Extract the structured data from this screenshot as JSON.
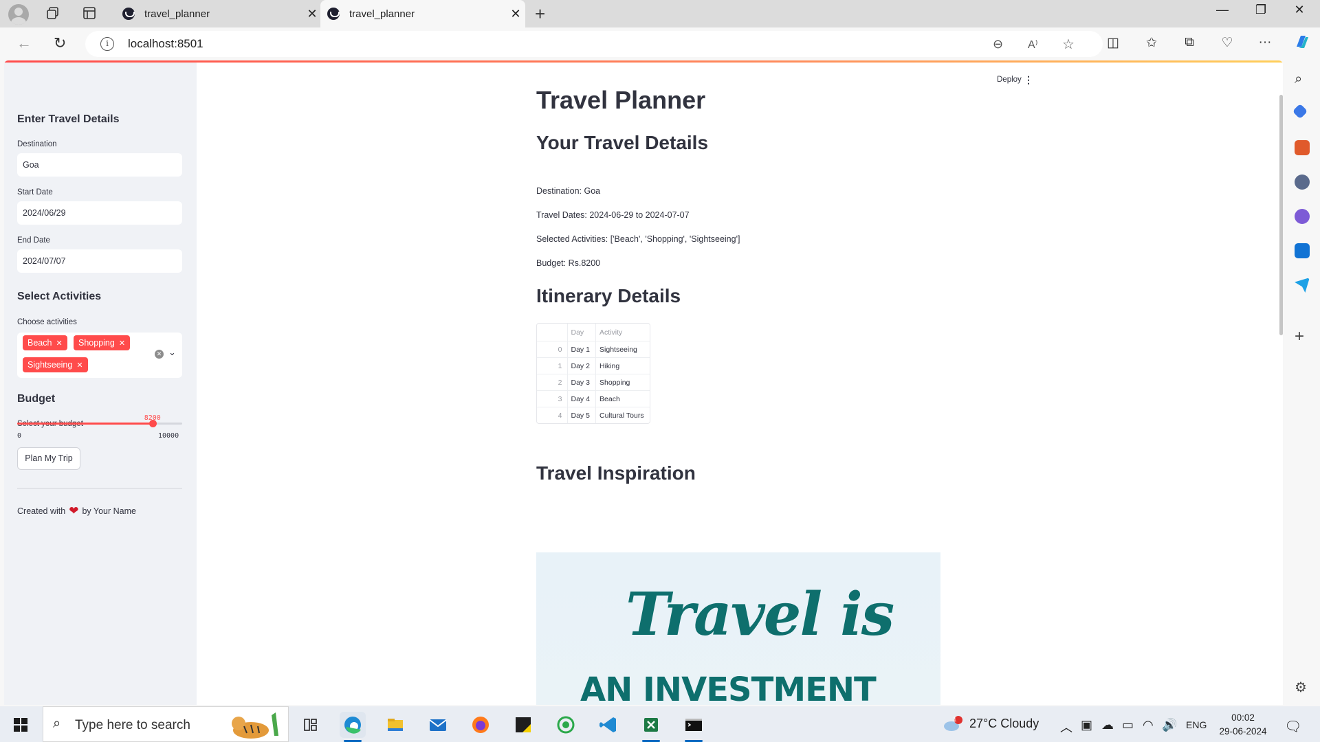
{
  "browser": {
    "tabs": [
      {
        "title": "travel_planner",
        "active": false
      },
      {
        "title": "travel_planner",
        "active": true
      }
    ],
    "url": "localhost:8501"
  },
  "header": {
    "deploy_label": "Deploy"
  },
  "sidebar": {
    "section_title": "Enter Travel Details",
    "destination_label": "Destination",
    "destination_value": "Goa",
    "start_date_label": "Start Date",
    "start_date_value": "2024/06/29",
    "end_date_label": "End Date",
    "end_date_value": "2024/07/07",
    "activities_title": "Select Activities",
    "activities_label": "Choose activities",
    "activities_selected": [
      "Beach",
      "Shopping",
      "Sightseeing"
    ],
    "budget_title": "Budget",
    "budget_label": "Select your budget",
    "budget_value": 8200,
    "budget_value_text": "8200",
    "budget_min": "0",
    "budget_max": "10000",
    "plan_button": "Plan My Trip",
    "footer_prefix": "Created with",
    "footer_suffix": "by Your Name"
  },
  "main": {
    "title": "Travel Planner",
    "details_heading": "Your Travel Details",
    "destination_line": "Destination: Goa",
    "dates_line": "Travel Dates: 2024-06-29 to 2024-07-07",
    "activities_line": "Selected Activities: ['Beach', 'Shopping', 'Sightseeing']",
    "budget_line": "Budget: Rs.8200",
    "itinerary_heading": "Itinerary Details",
    "itinerary_table": {
      "columns": [
        "",
        "Day",
        "Activity"
      ],
      "rows": [
        [
          "0",
          "Day 1",
          "Sightseeing"
        ],
        [
          "1",
          "Day 2",
          "Hiking"
        ],
        [
          "2",
          "Day 3",
          "Shopping"
        ],
        [
          "3",
          "Day 4",
          "Beach"
        ],
        [
          "4",
          "Day 5",
          "Cultural Tours"
        ]
      ]
    },
    "inspiration_heading": "Travel Inspiration",
    "inspiration_image_text": [
      "Travel is",
      "AN INVESTMENT"
    ]
  },
  "taskbar": {
    "search_placeholder": "Type here to search",
    "weather": "27°C  Cloudy",
    "weather_badge": "1",
    "language": "ENG",
    "time": "00:02",
    "date": "29-06-2024"
  },
  "colors": {
    "accent": "#ff4b4b",
    "sidebar_bg": "#f0f2f6",
    "text": "#31333f"
  }
}
